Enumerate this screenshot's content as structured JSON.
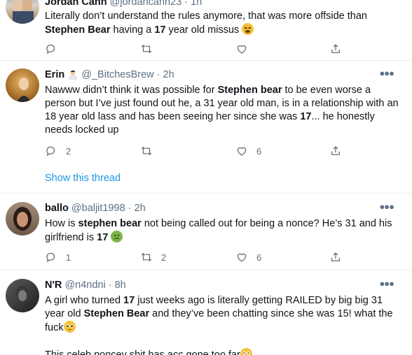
{
  "tweets": [
    {
      "name": "Jordan Cahn",
      "handle": "@jordancahn23",
      "time": "1h",
      "text_a": "Literally don’t understand the rules anymore, that was more offside than ",
      "text_b": "Stephen Bear",
      "text_c": " having a ",
      "text_d": "17",
      "text_e": " year old missus",
      "emoji": "tired-face-emoji"
    },
    {
      "name": "Erin",
      "handle": "@_BitchesBrew",
      "time": "2h",
      "text_a": "Nawww didn’t think it was possible for ",
      "text_b": "Stephen bear",
      "text_c": " to be even worse a person but I’ve just found out he, a 31 year old man, is in a relationship with an 18 year old lass and has been seeing her since she was ",
      "text_d": "17",
      "text_e": "... he honestly needs locked up",
      "replies": "2",
      "likes": "6",
      "show_thread": "Show this thread"
    },
    {
      "name": "ballo",
      "handle": "@baljit1998",
      "time": "2h",
      "text_a": "How is ",
      "text_b": "stephen bear",
      "text_c": " not being called out for being a nonce? He’s 31 and his girlfriend is ",
      "text_d": "17",
      "emoji": "nauseated-face-emoji",
      "replies": "1",
      "retweets": "2",
      "likes": "6"
    },
    {
      "name": "N'R",
      "handle": "@n4ndni",
      "time": "8h",
      "text_a": "A girl who turned ",
      "text_b": "17",
      "text_c": " just weeks ago is literally getting RAILED by big big 31 year old ",
      "text_d": "Stephen Bear",
      "text_e": " and they’ve been chatting since she was 15! what the fuck",
      "emoji": "pleading-face-emoji",
      "text_f": "This celeb noncey shit has acc gone too far",
      "emoji2": "flushed-face-emoji"
    }
  ],
  "separator": " · ",
  "colors": {
    "accent": "#1b95e0",
    "secondary": "#5b7083",
    "text": "#0f1419",
    "divider": "#ebeef0"
  }
}
